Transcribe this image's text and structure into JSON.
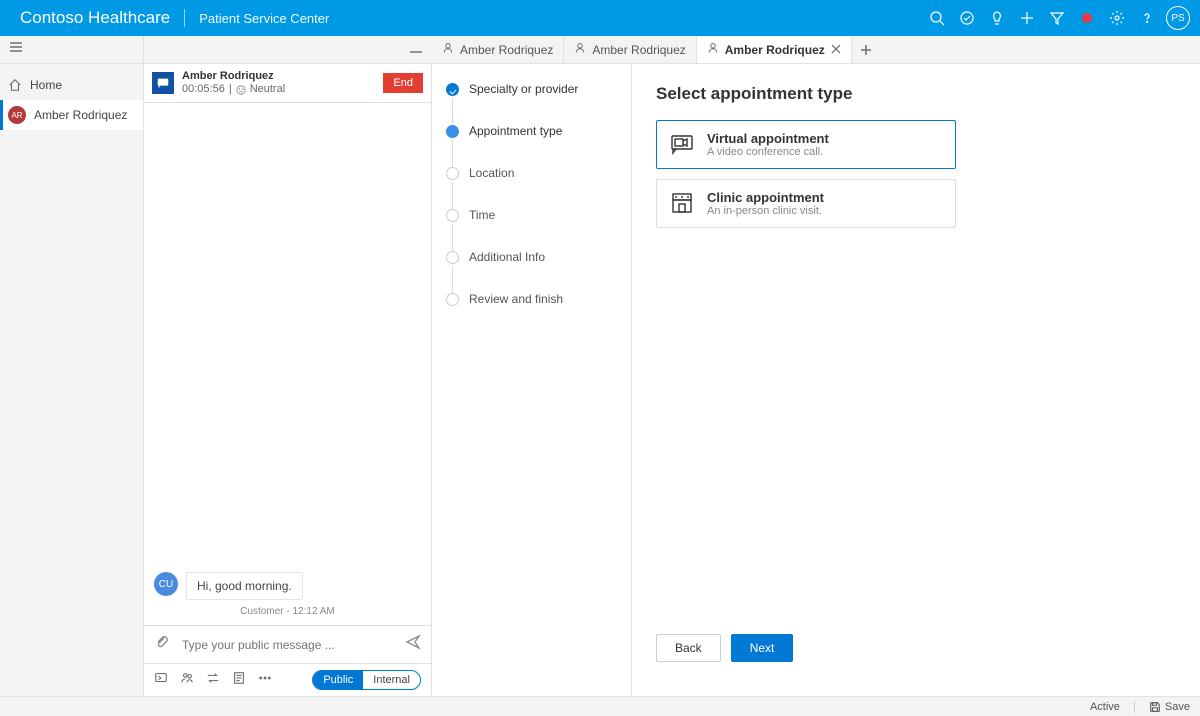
{
  "topbar": {
    "brand": "Contoso Healthcare",
    "subtitle": "Patient Service Center",
    "avatar": "PS"
  },
  "leftnav": {
    "home": "Home",
    "session": {
      "initials": "AR",
      "name": "Amber Rodriquez"
    }
  },
  "tabs": [
    {
      "label": "Amber Rodriquez",
      "active": false
    },
    {
      "label": "Amber Rodriquez",
      "active": false
    },
    {
      "label": "Amber Rodriquez",
      "active": true
    }
  ],
  "conversation": {
    "name": "Amber Rodriquez",
    "timer": "00:05:56",
    "sentiment": "Neutral",
    "end_label": "End",
    "message_avatar": "CU",
    "message_text": "Hi, good morning.",
    "message_meta": "Customer - 12:12 AM",
    "input_placeholder": "Type your public message ...",
    "seg_public": "Public",
    "seg_internal": "Internal"
  },
  "wizard": {
    "steps": [
      {
        "label": "Specialty or provider",
        "state": "done"
      },
      {
        "label": "Appointment type",
        "state": "current"
      },
      {
        "label": "Location",
        "state": "todo"
      },
      {
        "label": "Time",
        "state": "todo"
      },
      {
        "label": "Additional Info",
        "state": "todo"
      },
      {
        "label": "Review and finish",
        "state": "todo"
      }
    ]
  },
  "content": {
    "title": "Select appointment type",
    "cards": [
      {
        "title": "Virtual appointment",
        "desc": "A video conference call.",
        "selected": true
      },
      {
        "title": "Clinic appointment",
        "desc": "An in-person clinic visit.",
        "selected": false
      }
    ],
    "back": "Back",
    "next": "Next"
  },
  "footer": {
    "status": "Active",
    "save": "Save"
  }
}
